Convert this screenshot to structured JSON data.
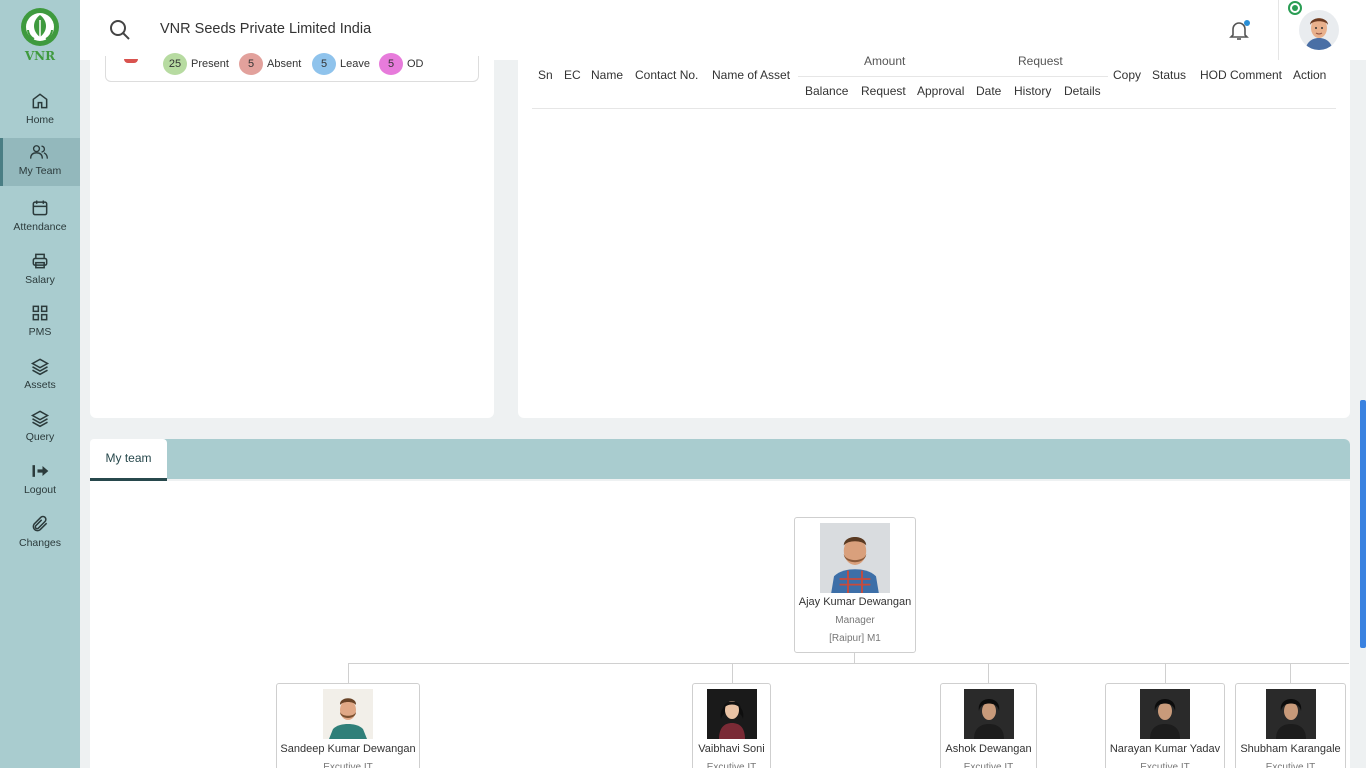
{
  "sidebar": {
    "logo_text": "VNR",
    "items": [
      {
        "label": "Home",
        "icon": "home-icon"
      },
      {
        "label": "My Team",
        "icon": "users-icon"
      },
      {
        "label": "Attendance",
        "icon": "calendar-icon"
      },
      {
        "label": "Salary",
        "icon": "printer-icon"
      },
      {
        "label": "PMS",
        "icon": "grid-icon"
      },
      {
        "label": "Assets",
        "icon": "layers-icon"
      },
      {
        "label": "Query",
        "icon": "layers-icon"
      },
      {
        "label": "Logout",
        "icon": "logout-icon"
      },
      {
        "label": "Changes",
        "icon": "paperclip-icon"
      }
    ]
  },
  "header": {
    "company": "VNR Seeds Private Limited India"
  },
  "attendance": {
    "present": {
      "count": "25",
      "label": "Present",
      "color": "#b7dba1"
    },
    "absent": {
      "count": "5",
      "label": "Absent",
      "color": "#e2a19c"
    },
    "leave": {
      "count": "5",
      "label": "Leave",
      "color": "#8fc3ec"
    },
    "od": {
      "count": "5",
      "label": "OD",
      "color": "#e77bdb"
    }
  },
  "asset_table": {
    "headers": {
      "sn": "Sn",
      "ec": "EC",
      "name": "Name",
      "contact": "Contact No.",
      "asset_name": "Name of Asset",
      "amount_group": "Amount",
      "balance": "Balance",
      "request": "Request",
      "approval": "Approval",
      "request_group": "Request",
      "date": "Date",
      "history": "History",
      "details": "Details",
      "copy": "Copy",
      "status": "Status",
      "hod_comment": "HOD Comment",
      "action": "Action"
    }
  },
  "team": {
    "tab_label": "My team",
    "manager": {
      "name": "Ajay Kumar Dewangan",
      "role": "Manager",
      "location": "[Raipur] M1"
    },
    "members": [
      {
        "name": "Sandeep Kumar Dewangan",
        "role": "Excutive IT"
      },
      {
        "name": "Vaibhavi Soni",
        "role": "Excutive IT"
      },
      {
        "name": "Ashok Dewangan",
        "role": "Excutive IT"
      },
      {
        "name": "Narayan Kumar Yadav",
        "role": "Excutive IT"
      },
      {
        "name": "Shubham Karangale",
        "role": "Excutive IT"
      }
    ]
  }
}
